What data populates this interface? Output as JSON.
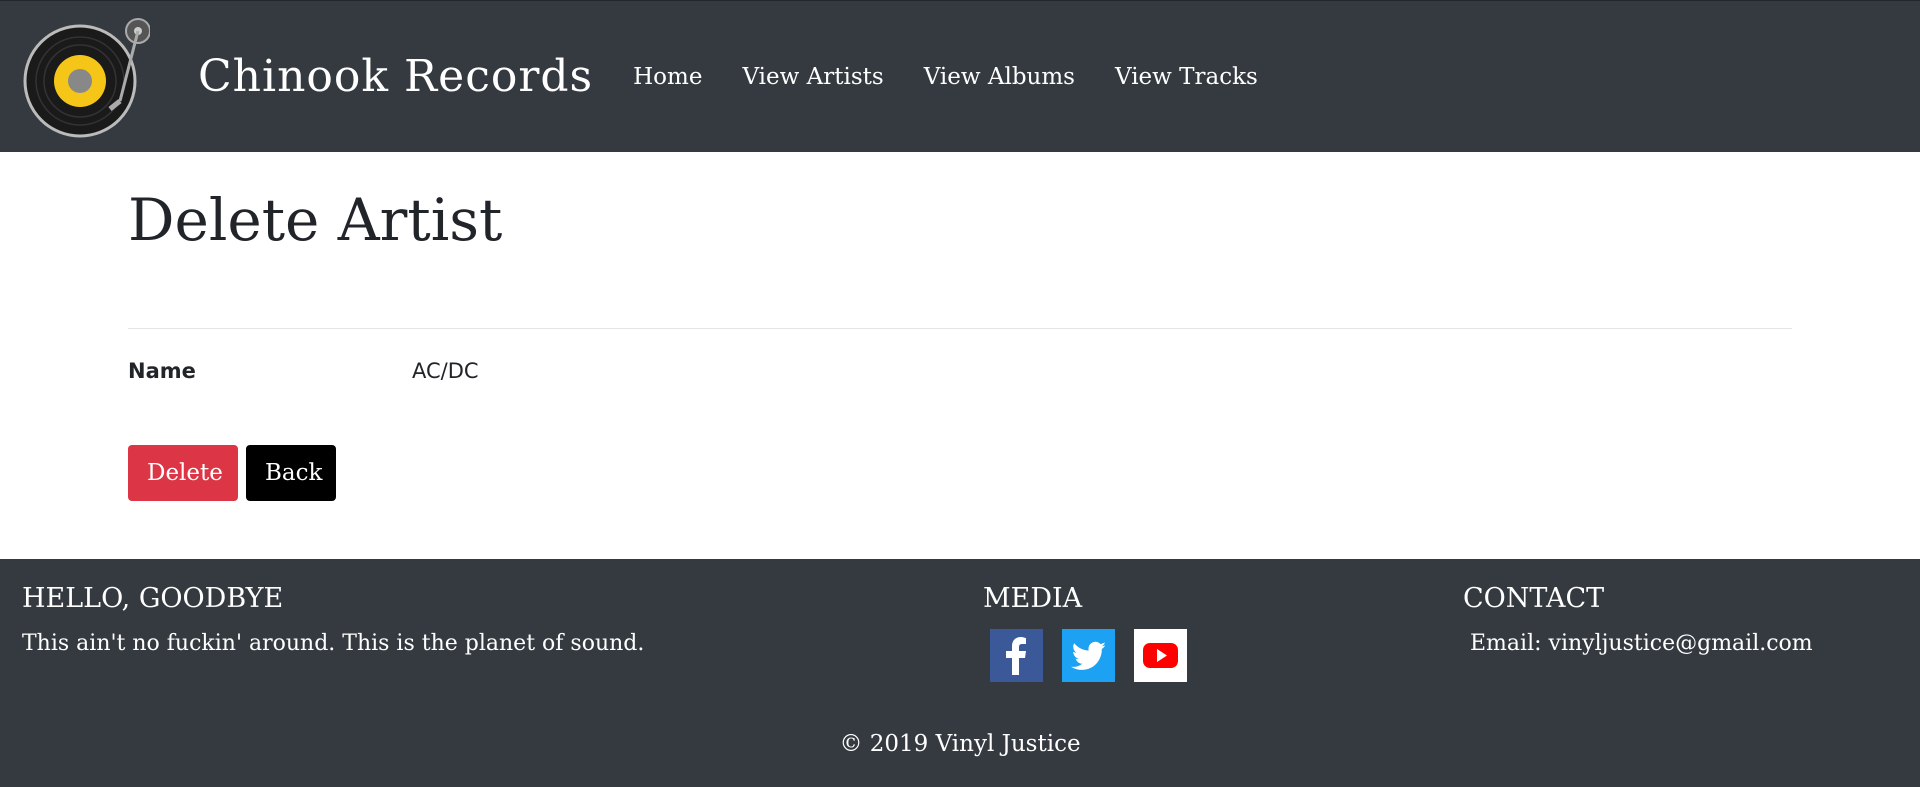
{
  "navbar": {
    "logo_icon": "vinyl-record-icon",
    "brand": "Chinook Records",
    "links": [
      "Home",
      "View Artists",
      "View Albums",
      "View Tracks"
    ]
  },
  "page": {
    "title": "Delete Artist",
    "fields": [
      {
        "label": "Name",
        "value": "AC/DC"
      }
    ],
    "buttons": {
      "delete": "Delete",
      "back": "Back"
    }
  },
  "footer": {
    "col1": {
      "heading": "HELLO, GOODBYE",
      "text": "This ain't no fuckin' around. This is the planet of sound."
    },
    "col2": {
      "heading": "MEDIA",
      "icons": [
        "facebook-icon",
        "twitter-icon",
        "youtube-icon"
      ]
    },
    "col3": {
      "heading": "CONTACT",
      "text": "Email: vinyljustice@gmail.com"
    },
    "copyright": "© 2019 Vinyl Justice"
  },
  "colors": {
    "navbar_bg": "#343a40",
    "delete_button": "#dc3545",
    "back_button": "#000000",
    "facebook": "#3b5998",
    "twitter": "#1da1f2",
    "youtube": "#ff0000"
  }
}
